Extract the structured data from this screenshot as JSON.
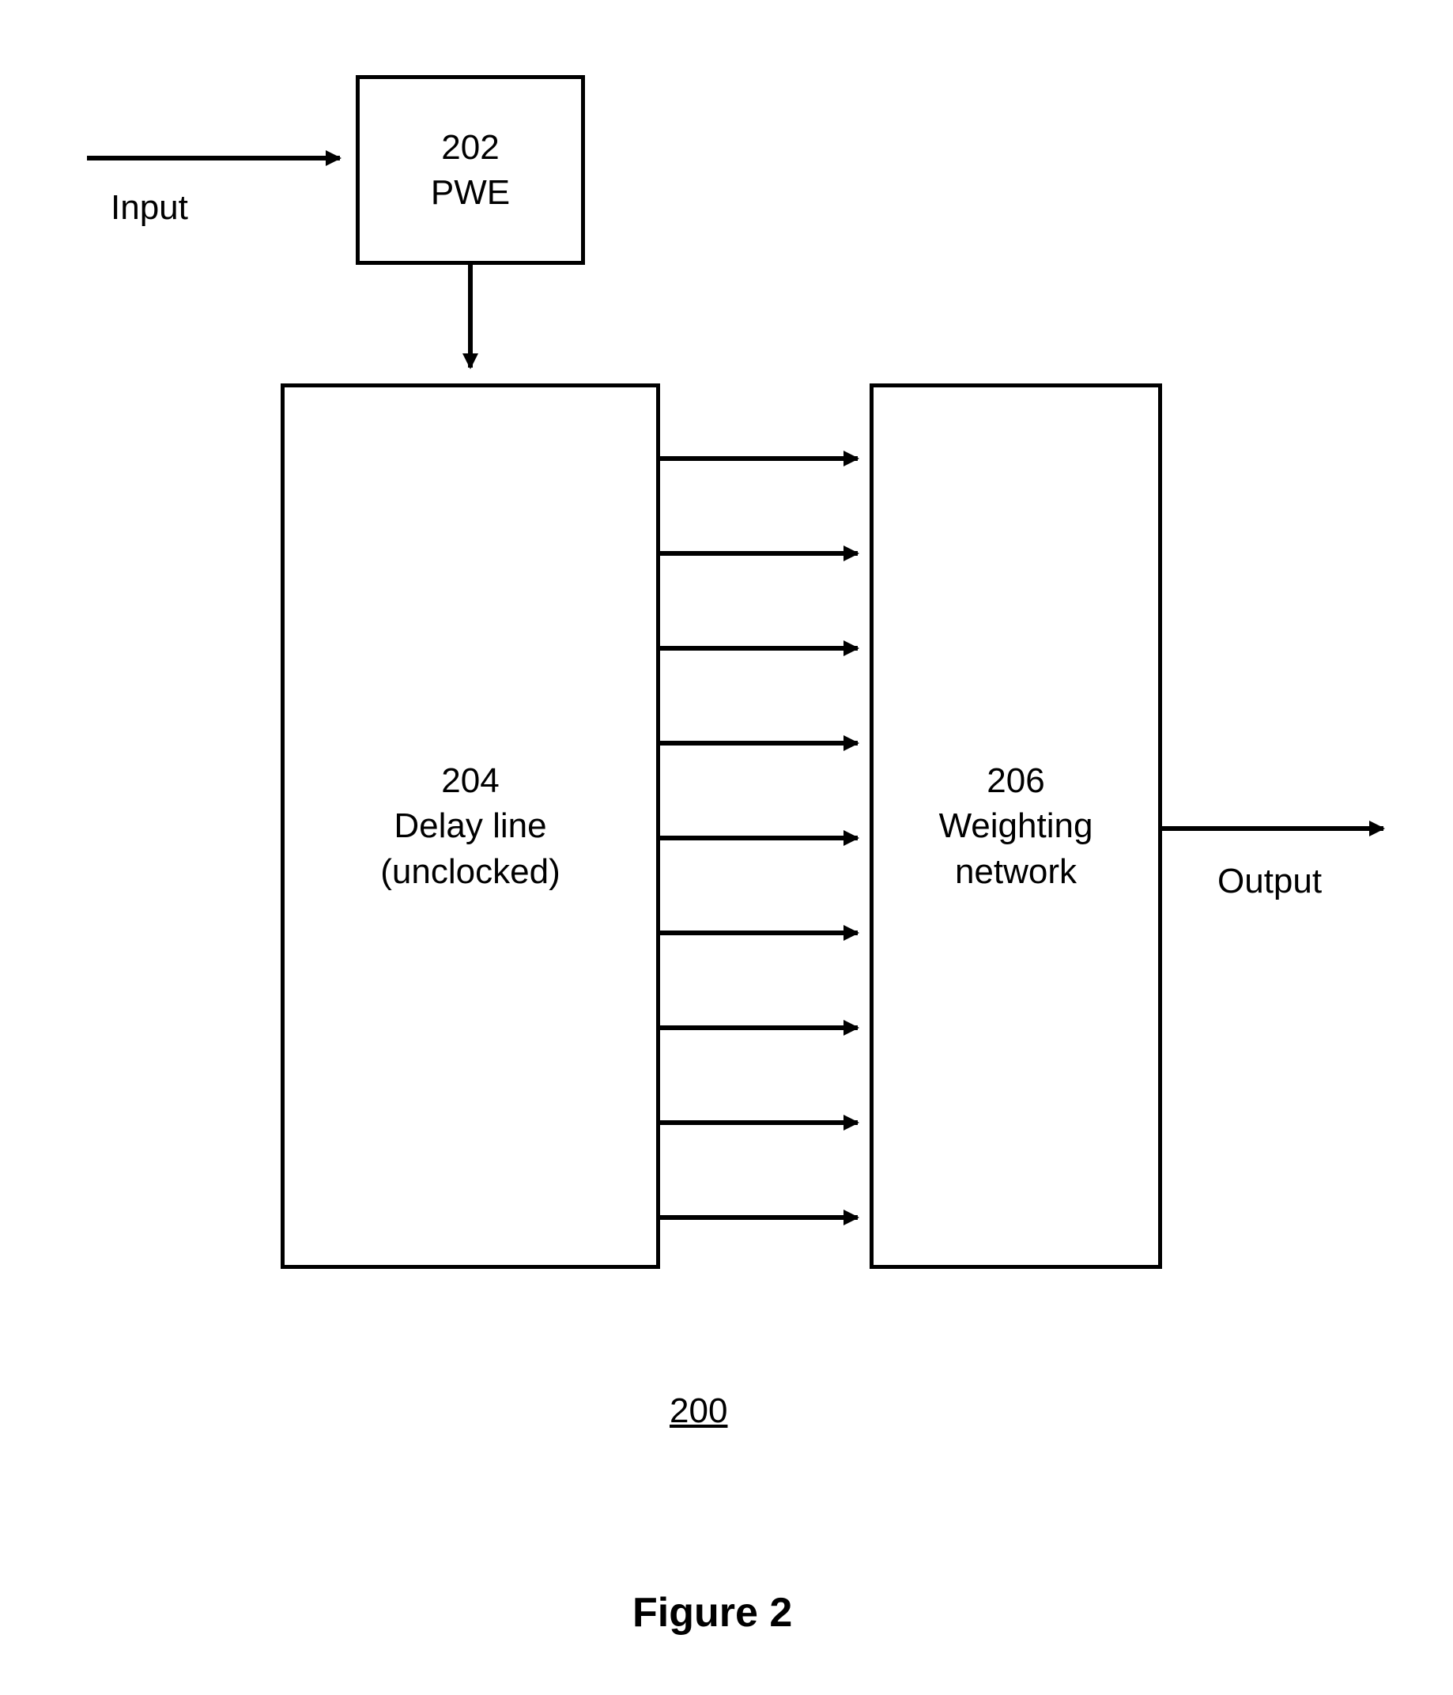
{
  "input_label": "Input",
  "output_label": "Output",
  "pwe": {
    "id": "202",
    "name": "PWE"
  },
  "delay_line": {
    "id": "204",
    "name1": "Delay line",
    "name2": "(unclocked)"
  },
  "weighting": {
    "id": "206",
    "name1": "Weighting",
    "name2": "network"
  },
  "figure_number": "200",
  "figure_caption": "Figure 2"
}
